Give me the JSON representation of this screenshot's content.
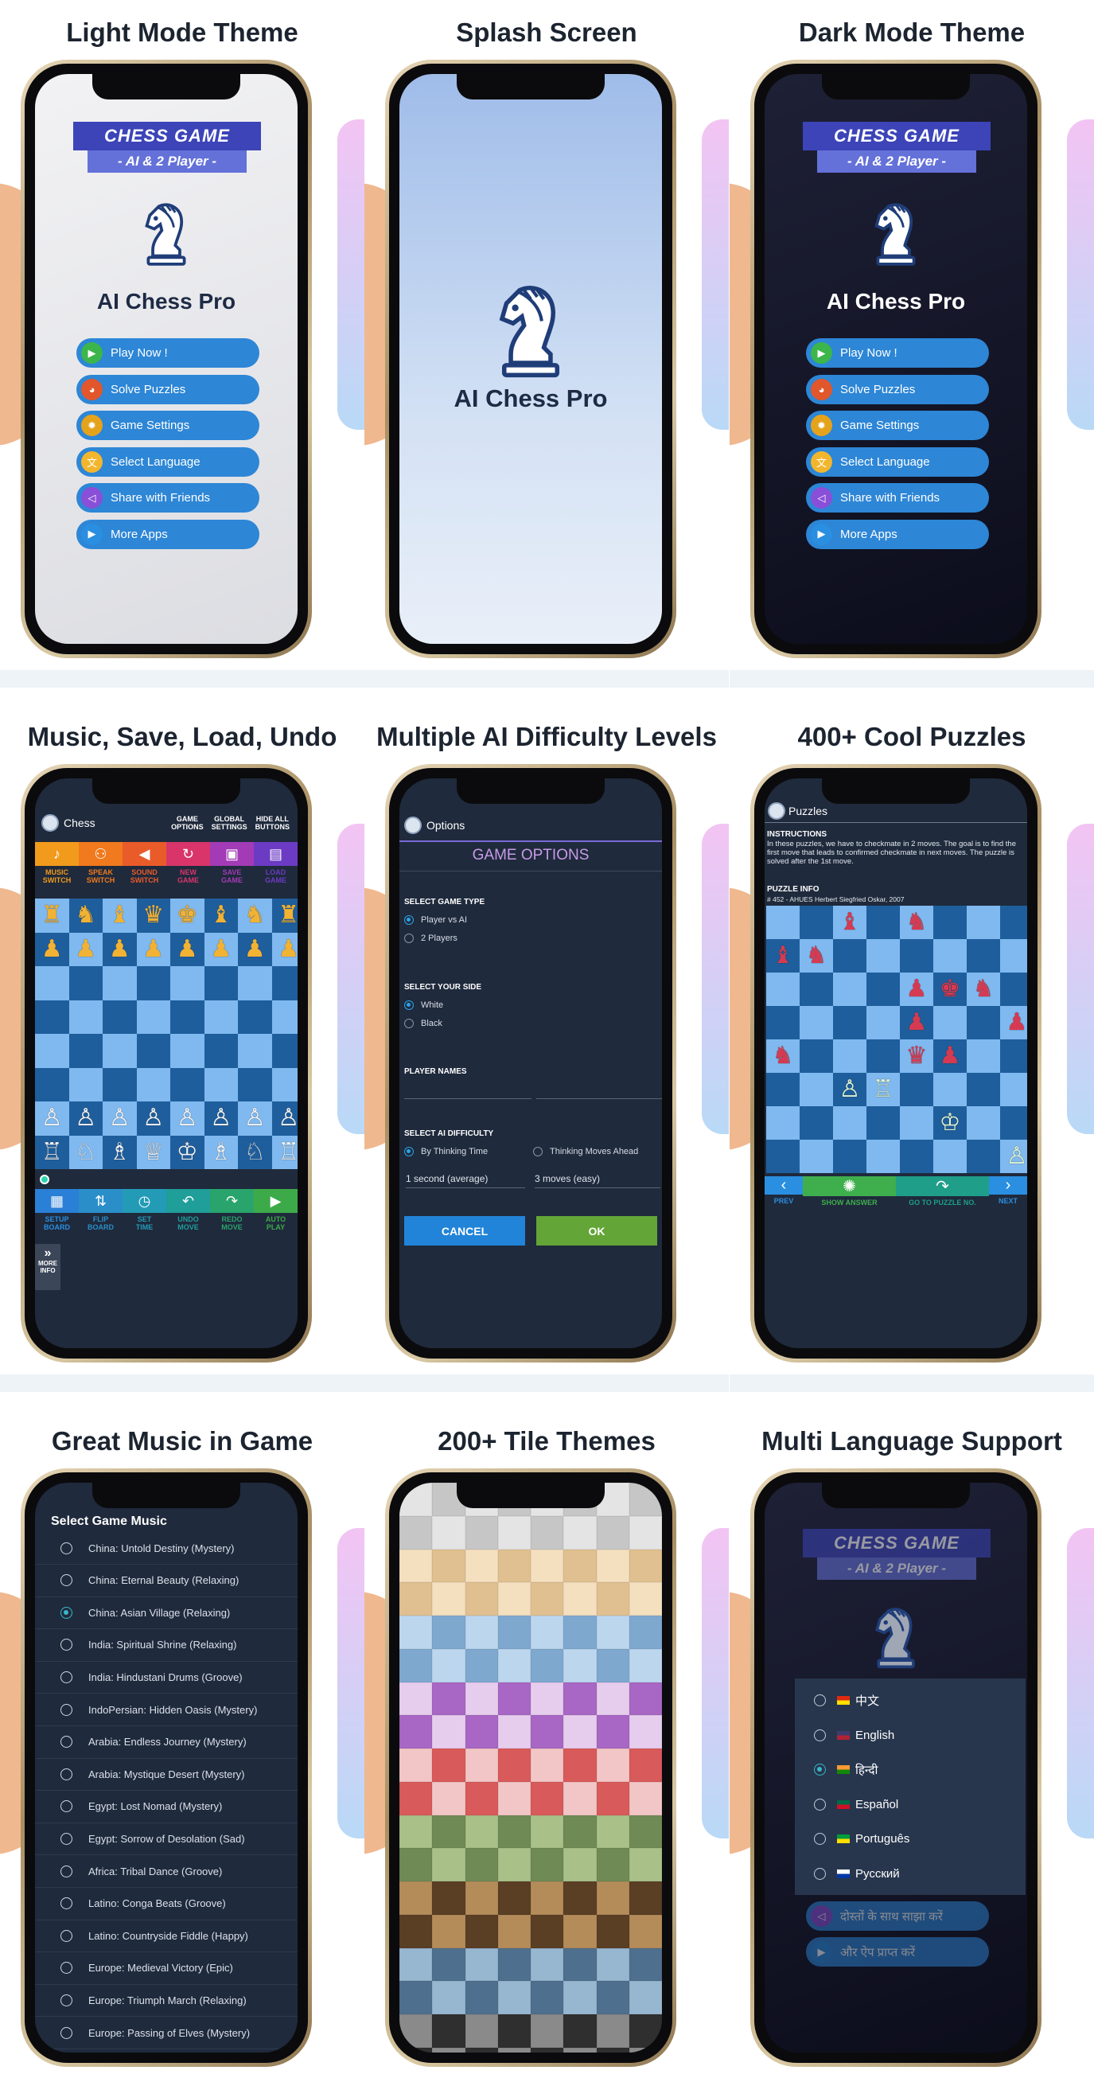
{
  "menu": {
    "banner_title": "CHESS GAME",
    "banner_sub": "- AI & 2 Player -",
    "app_name": "AI Chess Pro",
    "buttons": [
      {
        "label": "Play Now !",
        "color": "#3cb54a",
        "icon": "play-icon"
      },
      {
        "label": "Solve Puzzles",
        "color": "#e2562b",
        "icon": "puzzle-icon"
      },
      {
        "label": "Game Settings",
        "color": "#e5a31c",
        "icon": "gear-icon"
      },
      {
        "label": "Select Language",
        "color": "#f2b62e",
        "icon": "language-icon"
      },
      {
        "label": "Share with Friends",
        "color": "#8a4fd8",
        "icon": "share-icon"
      },
      {
        "label": "More Apps",
        "color": "#2a8fe0",
        "icon": "more-apps-icon"
      }
    ]
  },
  "captions": {
    "light": "Light Mode Theme",
    "splash": "Splash Screen",
    "dark": "Dark Mode Theme",
    "music": "Music, Save, Load, Undo",
    "ai": "Multiple AI Difficulty Levels",
    "puzzles": "400+ Cool Puzzles",
    "gamemusic": "Great Music in Game",
    "tiles": "200+ Tile Themes",
    "lang": "Multi Language Support"
  },
  "chess": {
    "title": "Chess",
    "top_buttons": [
      [
        "GAME",
        "OPTIONS"
      ],
      [
        "GLOBAL",
        "SETTINGS"
      ],
      [
        "HIDE ALL",
        "BUTTONS"
      ]
    ],
    "top_tools": [
      {
        "icon": "♪",
        "l1": "MUSIC",
        "l2": "SWITCH",
        "bg": "#f29a1c",
        "fg": "#f29a1c"
      },
      {
        "icon": "⚇",
        "l1": "SPEAK",
        "l2": "SWITCH",
        "bg": "#f07a1d",
        "fg": "#f07a1d"
      },
      {
        "icon": "◀",
        "l1": "SOUND",
        "l2": "SWITCH",
        "bg": "#ea5b2a",
        "fg": "#ea5b2a"
      },
      {
        "icon": "↻",
        "l1": "NEW",
        "l2": "GAME",
        "bg": "#d9356a",
        "fg": "#d9356a"
      },
      {
        "icon": "▣",
        "l1": "SAVE",
        "l2": "GAME",
        "bg": "#a23bb5",
        "fg": "#a23bb5"
      },
      {
        "icon": "▤",
        "l1": "LOAD",
        "l2": "GAME",
        "bg": "#6c3bc4",
        "fg": "#6c3bc4"
      }
    ],
    "bottom_tools": [
      {
        "icon": "▦",
        "l1": "SETUP",
        "l2": "BOARD",
        "bg": "#2a7fd6",
        "fg": "#2a8fe0"
      },
      {
        "icon": "⇅",
        "l1": "FLIP",
        "l2": "BOARD",
        "bg": "#2a8ec9",
        "fg": "#2a8ec9"
      },
      {
        "icon": "◷",
        "l1": "SET",
        "l2": "TIME",
        "bg": "#239bb6",
        "fg": "#239bb6"
      },
      {
        "icon": "↶",
        "l1": "UNDO",
        "l2": "MOVE",
        "bg": "#1f9e9a",
        "fg": "#1f9e9a"
      },
      {
        "icon": "↷",
        "l1": "REDO",
        "l2": "MOVE",
        "bg": "#29a46c",
        "fg": "#29a46c"
      },
      {
        "icon": "▶",
        "l1": "AUTO",
        "l2": "PLAY",
        "bg": "#3daa4a",
        "fg": "#3daa4a"
      }
    ],
    "more_info": [
      "MORE",
      "INFO"
    ],
    "board": [
      "♜♞♝♛♚♝♞♜",
      "♟♟♟♟♟♟♟♟",
      "        ",
      "        ",
      "        ",
      "        ",
      "♙♙♙♙♙♙♙♙",
      "♖♘♗♕♔♗♘♖"
    ]
  },
  "options": {
    "title": "Options",
    "heading": "GAME OPTIONS",
    "game_type_label": "SELECT GAME TYPE",
    "game_types": [
      "Player vs AI",
      "2 Players"
    ],
    "side_label": "SELECT YOUR SIDE",
    "sides": [
      "White",
      "Black"
    ],
    "names_label": "PLAYER NAMES",
    "difficulty_label": "SELECT AI DIFFICULTY",
    "diff_modes": [
      "By Thinking Time",
      "Thinking Moves Ahead"
    ],
    "diff_time": "1 second (average)",
    "diff_moves": "3 moves (easy)",
    "cancel": "CANCEL",
    "ok": "OK"
  },
  "puzzles": {
    "title": "Puzzles",
    "instr_label": "INSTRUCTIONS",
    "instr_text": "In these puzzles, we have to checkmate in 2 moves. The goal is to find the first move that leads to confirmed checkmate in next moves. The puzzle is solved after the 1st move.",
    "info_label": "PUZZLE INFO",
    "info_text": "# 452 - AHUES Herbert Siegfried Oskar, 2007",
    "board": [
      "  ♝ ♞   ",
      "♝♞      ",
      "    ♟♚♞ ",
      "    ♟  ♟",
      "♞   ♛♟  ",
      "  ♙♖    ",
      "     ♔  ",
      "       ♙"
    ],
    "nav": [
      "PREV",
      "SHOW ANSWER",
      "GO TO PUZZLE NO.",
      "NEXT"
    ]
  },
  "music": {
    "title": "Select Game Music",
    "tracks": [
      "China: Untold Destiny (Mystery)",
      "China: Eternal Beauty (Relaxing)",
      "China: Asian Village (Relaxing)",
      "India: Spiritual Shrine (Relaxing)",
      "India: Hindustani Drums (Groove)",
      "IndoPersian: Hidden Oasis (Mystery)",
      "Arabia: Endless Journey (Mystery)",
      "Arabia: Mystique Desert (Mystery)",
      "Egypt: Lost Nomad (Mystery)",
      "Egypt: Sorrow of Desolation (Sad)",
      "Africa: Tribal Dance (Groove)",
      "Latino: Conga Beats (Groove)",
      "Latino: Countryside Fiddle (Happy)",
      "Europe: Medieval Victory (Epic)",
      "Europe: Triumph March (Relaxing)",
      "Europe: Passing of Elves (Mystery)"
    ],
    "selected": 2
  },
  "tiles": [
    {
      "a": "#e4e4e4",
      "b": "#c6c6c6"
    },
    {
      "a": "#f4dfbf",
      "b": "#e0c090"
    },
    {
      "a": "#bcd6ee",
      "b": "#7fa8cf"
    },
    {
      "a": "#e6cdee",
      "b": "#a867c4"
    },
    {
      "a": "#f2c6c6",
      "b": "#d85a5a"
    },
    {
      "a": "#a9c189",
      "b": "#6f8a55"
    },
    {
      "a": "#b48c5a",
      "b": "#5a3f25"
    },
    {
      "a": "#97b6d0",
      "b": "#4f6f8e"
    },
    {
      "a": "#8a8a8a",
      "b": "#2f2f2f"
    }
  ],
  "language": {
    "banner_title": "CHESS GAME",
    "banner_sub": "- AI & 2 Player -",
    "options": [
      {
        "label": "中文",
        "flag": "#de2910",
        "flag2": "#ffde00"
      },
      {
        "label": "English",
        "flag": "#3c3b6e",
        "flag2": "#b22234"
      },
      {
        "label": "हिन्दी",
        "flag": "#ff9933",
        "flag2": "#138808"
      },
      {
        "label": "Español",
        "flag": "#006847",
        "flag2": "#ce1126"
      },
      {
        "label": "Português",
        "flag": "#009c3b",
        "flag2": "#ffdf00"
      },
      {
        "label": "Русский",
        "flag": "#ffffff",
        "flag2": "#0039a6"
      }
    ],
    "selected": 2,
    "btn_share": "दोस्तों के साथ साझा करें",
    "btn_more": "और ऐप प्राप्त करें"
  }
}
